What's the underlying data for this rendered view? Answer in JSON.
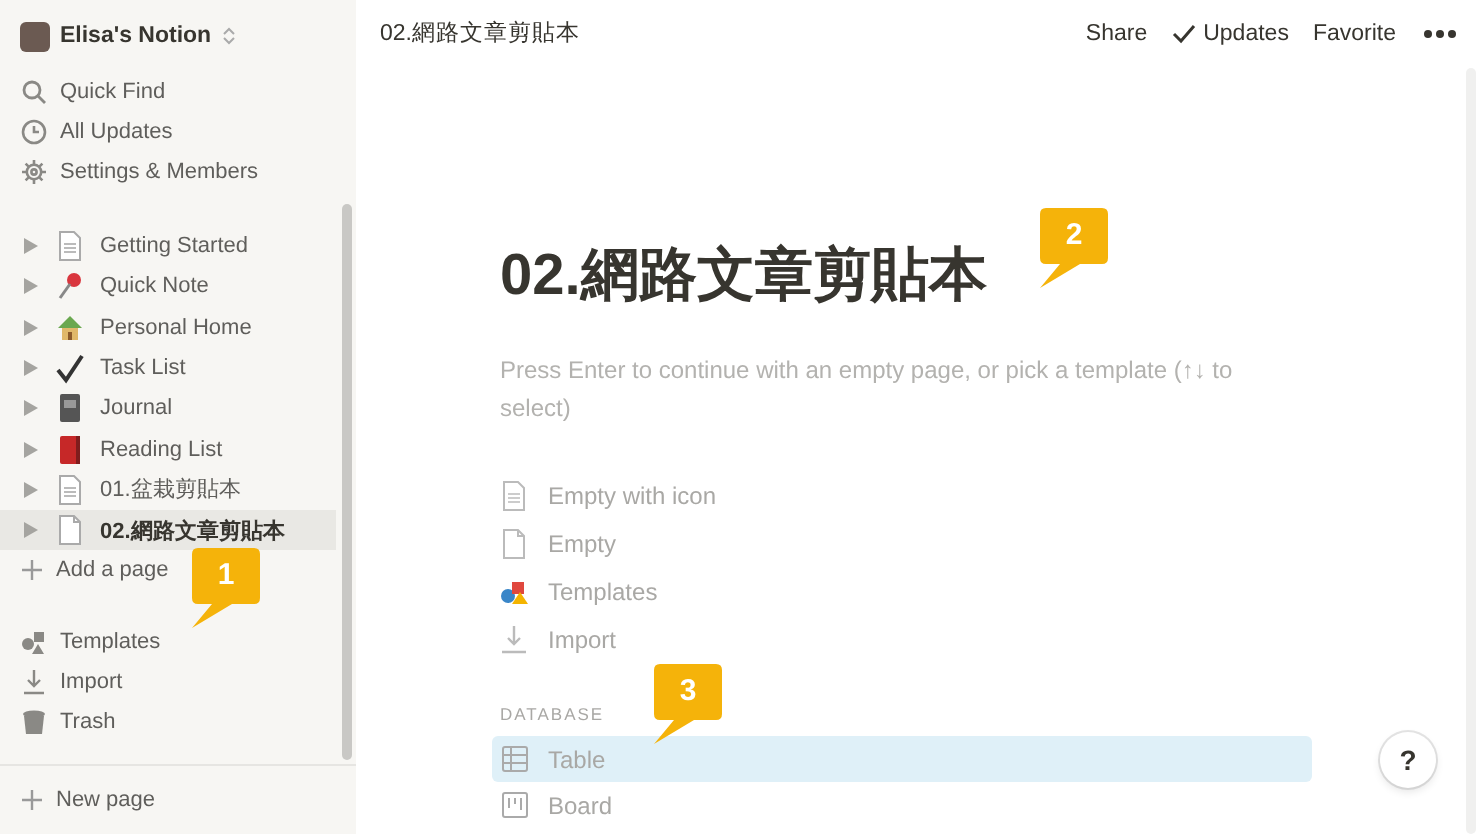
{
  "workspace": {
    "name": "Elisa's Notion"
  },
  "sidebar_nav": [
    {
      "label": "Quick Find"
    },
    {
      "label": "All Updates"
    },
    {
      "label": "Settings & Members"
    }
  ],
  "pages": [
    {
      "title": "Getting Started",
      "selected": false
    },
    {
      "title": "Quick Note",
      "selected": false
    },
    {
      "title": "Personal Home",
      "selected": false
    },
    {
      "title": "Task List",
      "selected": false
    },
    {
      "title": "Journal",
      "selected": false
    },
    {
      "title": "Reading List",
      "selected": false
    },
    {
      "title": "01.盆栽剪貼本",
      "selected": false
    },
    {
      "title": "02.網路文章剪貼本",
      "selected": true
    }
  ],
  "add_page": "Add a page",
  "sidebar_tools": [
    {
      "label": "Templates"
    },
    {
      "label": "Import"
    },
    {
      "label": "Trash"
    }
  ],
  "new_page": "New page",
  "topbar": {
    "breadcrumb": "02.網路文章剪貼本",
    "actions": [
      {
        "label": "Share"
      },
      {
        "label": "Updates"
      },
      {
        "label": "Favorite"
      }
    ]
  },
  "page": {
    "title": "02.網路文章剪貼本",
    "hint": "Press Enter to continue with an empty page, or pick a template (↑↓ to select)",
    "options": [
      {
        "label": "Empty with icon"
      },
      {
        "label": "Empty"
      },
      {
        "label": "Templates"
      },
      {
        "label": "Import"
      }
    ],
    "database_heading": "DATABASE",
    "database_options": [
      {
        "label": "Table",
        "selected": true
      },
      {
        "label": "Board",
        "selected": false
      }
    ]
  },
  "help": "?",
  "callouts": [
    {
      "number": "1"
    },
    {
      "number": "2"
    },
    {
      "number": "3"
    }
  ]
}
